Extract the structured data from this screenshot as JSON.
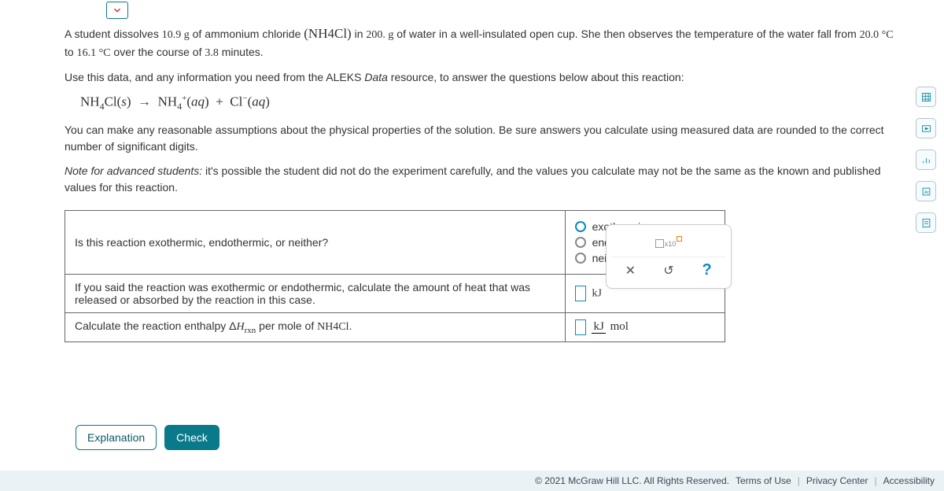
{
  "problem": {
    "p1_a": "A student dissolves ",
    "mass_solute": "10.9 g",
    "p1_b": " of ammonium chloride ",
    "formula_inline": "(NH₄Cl)",
    "p1_c": " in ",
    "mass_water": "200. g",
    "p1_d": " of water in a well-insulated open cup. She then observes the temperature of the water fall from ",
    "t_start": "20.0 °C",
    "p1_e": " to ",
    "t_end": "16.1 °C",
    "p1_f": " over the course of ",
    "time": "3.8",
    "p1_g": " minutes.",
    "p2": "Use this data, and any information you need from the ALEKS ",
    "data_word": "Data",
    "p2_b": " resource, to answer the questions below about this reaction:",
    "eqn": "NH₄Cl(s)  →  NH₄⁺(aq)  +  Cl⁻(aq)",
    "p3": "You can make any reasonable assumptions about the physical properties of the solution. Be sure answers you calculate using measured data are rounded to the correct number of significant digits.",
    "note_lead": "Note for advanced students:",
    "note_body": " it's possible the student did not do the experiment carefully, and the values you calculate may not be the same as the known and published values for this reaction."
  },
  "questions": {
    "q1": "Is this reaction exothermic, endothermic, or neither?",
    "q1_options": {
      "a": "exothermic",
      "b": "endothermic",
      "c": "neither"
    },
    "q1_selected": "a",
    "q2": "If you said the reaction was exothermic or endothermic, calculate the amount of heat that was released or absorbed by the reaction in this case.",
    "q2_unit": "kJ",
    "q3_a": "Calculate the reaction enthalpy Δ",
    "q3_H": "H",
    "q3_sub": "rxn",
    "q3_b": " per mole of ",
    "q3_formula": "NH₄Cl",
    "q3_c": ".",
    "q3_unit_top": "kJ",
    "q3_unit_bot": "mol"
  },
  "toolbox": {
    "x10": "x10",
    "clear": "✕",
    "reset": "↺",
    "help": "?"
  },
  "buttons": {
    "explanation": "Explanation",
    "check": "Check"
  },
  "footer": {
    "copyright": "© 2021 McGraw Hill LLC. All Rights Reserved.",
    "terms": "Terms of Use",
    "privacy": "Privacy Center",
    "access": "Accessibility"
  }
}
